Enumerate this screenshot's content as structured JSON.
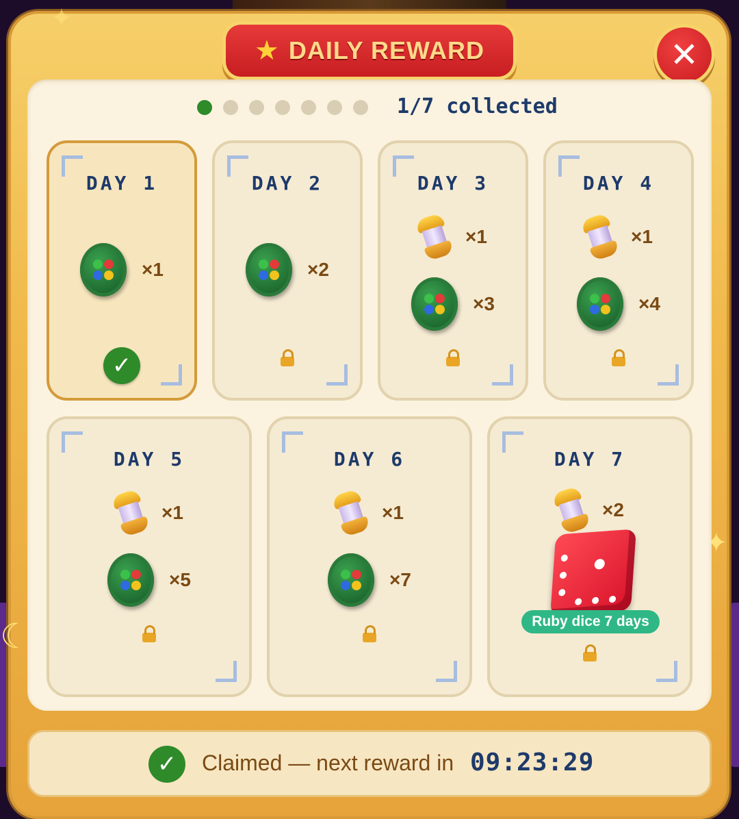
{
  "header": {
    "title": "DAILY REWARD",
    "title_icon": "star-icon",
    "close_icon": "close-icon"
  },
  "progress": {
    "collected": 1,
    "total": 7,
    "label": "1/7 collected"
  },
  "days": [
    {
      "label": "DAY 1",
      "status": "claimed",
      "rewards": [
        {
          "item": "green-chip-coin",
          "qty": "×1"
        }
      ]
    },
    {
      "label": "DAY 2",
      "status": "locked",
      "rewards": [
        {
          "item": "green-chip-coin",
          "qty": "×2"
        }
      ]
    },
    {
      "label": "DAY 3",
      "status": "locked",
      "rewards": [
        {
          "item": "gold-capsule",
          "qty": "×1"
        },
        {
          "item": "green-chip-coin",
          "qty": "×3"
        }
      ]
    },
    {
      "label": "DAY 4",
      "status": "locked",
      "rewards": [
        {
          "item": "gold-capsule",
          "qty": "×1"
        },
        {
          "item": "green-chip-coin",
          "qty": "×4"
        }
      ]
    },
    {
      "label": "DAY 5",
      "status": "locked",
      "rewards": [
        {
          "item": "gold-capsule",
          "qty": "×1"
        },
        {
          "item": "green-chip-coin",
          "qty": "×5"
        }
      ]
    },
    {
      "label": "DAY 6",
      "status": "locked",
      "rewards": [
        {
          "item": "gold-capsule",
          "qty": "×1"
        },
        {
          "item": "green-chip-coin",
          "qty": "×7"
        }
      ]
    },
    {
      "label": "DAY 7",
      "status": "locked",
      "rewards": [
        {
          "item": "gold-capsule",
          "qty": "×2"
        },
        {
          "item": "ruby-dice",
          "tag": "Ruby dice 7 days"
        }
      ]
    }
  ],
  "footer": {
    "status_text": "Claimed — next reward in",
    "timer": "09:23:29"
  },
  "colors": {
    "frame": "#f0b94a",
    "title_banner": "#d42a2e",
    "claimed_green": "#2f8a2a",
    "day_text": "#1e3a6a",
    "qty_text": "#7a4a14",
    "dice_tag": "#2fb886"
  }
}
